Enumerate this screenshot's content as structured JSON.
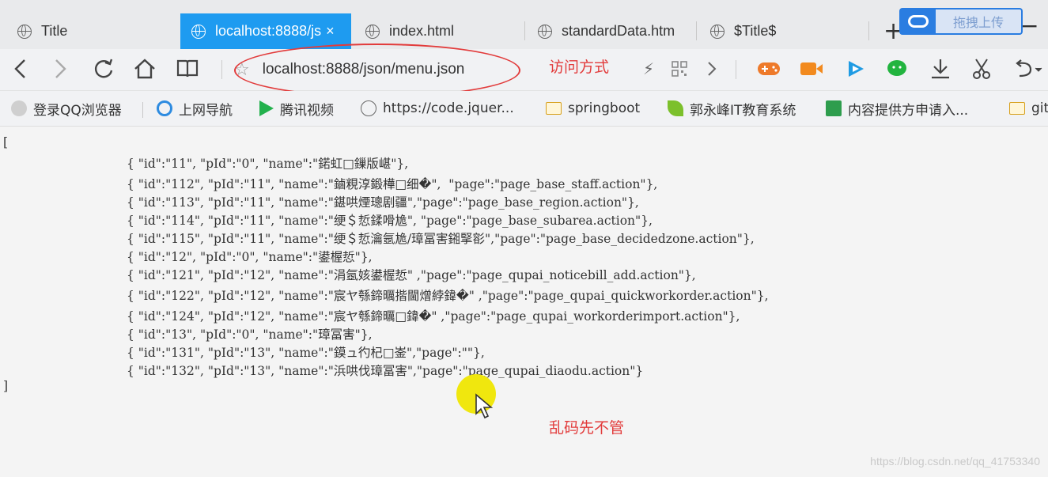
{
  "tabs": [
    {
      "label": "Title",
      "active": false
    },
    {
      "label": "localhost:8888/js",
      "active": true
    },
    {
      "label": "index.html",
      "active": false
    },
    {
      "label": "standardData.htm",
      "active": false
    },
    {
      "label": "$Title$",
      "active": false
    }
  ],
  "tab_close_glyph": "×",
  "new_tab_glyph": "+",
  "minimize_glyph": "−",
  "upload_button_label": "拖拽上传",
  "address": {
    "url": "localhost:8888/json/menu.json"
  },
  "annotations": {
    "access_method": "访问方式",
    "garbled_note": "乱码先不管"
  },
  "bookmarks": [
    {
      "label": "登录QQ浏览器",
      "icon": "qq-avatar-icon"
    },
    {
      "label": "上网导航",
      "icon": "ie-icon"
    },
    {
      "label": "腾讯视频",
      "icon": "tencent-video-icon"
    },
    {
      "label": "https://code.jquer...",
      "icon": "globe-icon"
    },
    {
      "label": "springboot",
      "icon": "folder-icon"
    },
    {
      "label": "郭永峰IT教育系统",
      "icon": "leaf-icon"
    },
    {
      "label": "内容提供方申请入...",
      "icon": "book-icon"
    },
    {
      "label": "git",
      "icon": "folder-icon"
    }
  ],
  "json_open": "[",
  "json_close": "]",
  "json_lines": [
    "{ \"id\":\"11\", \"pId\":\"0\", \"name\":\"鍩虹□鏁版嵁\"},",
    "{ \"id\":\"112\", \"pId\":\"11\", \"name\":\"鏀粯淳鍛樺□细�\",  \"page\":\"page_base_staff.action\"},",
    "{ \"id\":\"113\", \"pId\":\"11\", \"name\":\"鍖哄煙璁剧疆\",\"page\":\"page_base_region.action\"},",
    "{ \"id\":\"114\", \"pId\":\"11\", \"name\":\"绠＄悊鍒嗗尯\", \"page\":\"page_base_subarea.action\"},",
    "{ \"id\":\"115\", \"pId\":\"11\", \"name\":\"绠＄悊瀹氬尯/璋冨害鎺掔彮\",\"page\":\"page_base_decidedzone.action\"},",
    "{ \"id\":\"12\", \"pId\":\"0\", \"name\":\"鍙楃悊\"},",
    "{ \"id\":\"121\", \"pId\":\"12\", \"name\":\"涓氬姟鍙楃悊\" ,\"page\":\"page_qupai_noticebill_add.action\"},",
    "{ \"id\":\"122\", \"pId\":\"12\", \"name\":\"宸ヤ綔鍗曞揩閫熷綍鍏�\" ,\"page\":\"page_qupai_quickworkorder.action\"},",
    "{ \"id\":\"124\", \"pId\":\"12\", \"name\":\"宸ヤ綔鍗曞□鍏�\" ,\"page\":\"page_qupai_workorderimport.action\"},",
    "{ \"id\":\"13\", \"pId\":\"0\", \"name\":\"璋冨害\"},",
    "{ \"id\":\"131\", \"pId\":\"13\", \"name\":\"鏌ュ彴杞□崟\",\"page\":\"\"},",
    "{ \"id\":\"132\", \"pId\":\"13\", \"name\":\"浜哄伐璋冨害\",\"page\":\"page_qupai_diaodu.action\"}"
  ],
  "watermark": "https://blog.csdn.net/qq_41753340"
}
